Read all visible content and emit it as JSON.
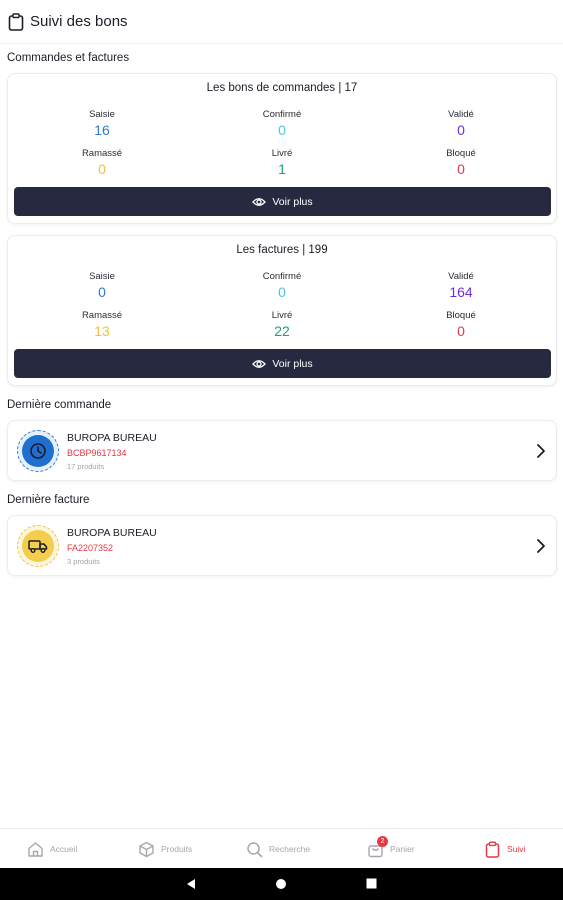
{
  "header": {
    "title": "Suivi des bons",
    "icon": "clipboard-icon"
  },
  "section_orders_invoices": "Commandes et factures",
  "orders_card": {
    "title": "Les bons de commandes | 17",
    "stats": [
      {
        "label": "Saisie",
        "value": "16",
        "color": "#2f7ad6"
      },
      {
        "label": "Confirmé",
        "value": "0",
        "color": "#4fc3e6"
      },
      {
        "label": "Validé",
        "value": "0",
        "color": "#6a2fd8"
      },
      {
        "label": "Ramassé",
        "value": "0",
        "color": "#f0c23c"
      },
      {
        "label": "Livré",
        "value": "1",
        "color": "#17a37c"
      },
      {
        "label": "Bloqué",
        "value": "0",
        "color": "#e53946"
      }
    ],
    "button": "Voir plus"
  },
  "invoices_card": {
    "title": "Les factures | 199",
    "stats": [
      {
        "label": "Saisie",
        "value": "0",
        "color": "#2f7ad6"
      },
      {
        "label": "Confirmé",
        "value": "0",
        "color": "#4fc3e6"
      },
      {
        "label": "Validé",
        "value": "164",
        "color": "#6a2fd8"
      },
      {
        "label": "Ramassé",
        "value": "13",
        "color": "#f0c23c"
      },
      {
        "label": "Livré",
        "value": "22",
        "color": "#17a37c"
      },
      {
        "label": "Bloqué",
        "value": "0",
        "color": "#e53946"
      }
    ],
    "button": "Voir plus"
  },
  "last_order": {
    "section": "Dernière commande",
    "client": "BUROPA BUREAU",
    "ref": "BCBP9617134",
    "products": "17 produits",
    "icon": "clock-icon"
  },
  "last_invoice": {
    "section": "Dernière facture",
    "client": "BUROPA BUREAU",
    "ref": "FA2207352",
    "products": "3 produits",
    "icon": "truck-icon"
  },
  "bottom_nav": {
    "items": [
      {
        "label": "Accueil",
        "icon": "home-icon"
      },
      {
        "label": "Produits",
        "icon": "box-icon"
      },
      {
        "label": "Recherche",
        "icon": "search-icon"
      },
      {
        "label": "Panier",
        "icon": "cart-icon",
        "badge": "2"
      },
      {
        "label": "Suivi",
        "icon": "clipboard-icon",
        "active": true
      }
    ]
  },
  "colors": {
    "accent": "#e53946",
    "button_bg": "#262940"
  }
}
